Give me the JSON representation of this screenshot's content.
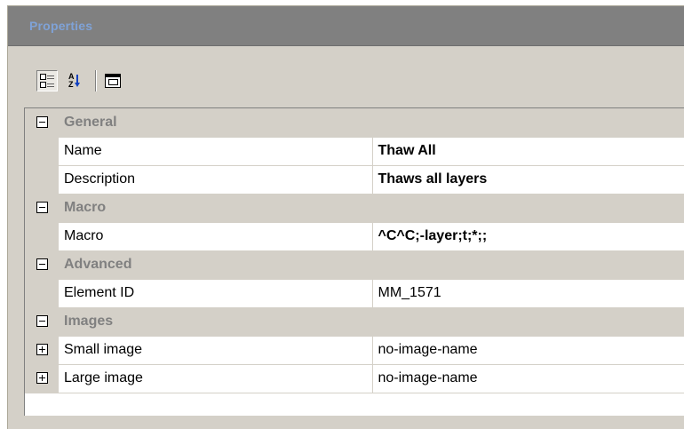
{
  "panel": {
    "title": "Properties"
  },
  "toolbar": {
    "buttons": [
      {
        "icon": "categorized-icon",
        "active": true
      },
      {
        "icon": "alphabetical-sort-icon",
        "label": "A Z",
        "active": false
      },
      {
        "icon": "property-pages-icon",
        "active": false
      }
    ]
  },
  "grid": {
    "categories": [
      {
        "label": "General",
        "expanded": true,
        "properties": [
          {
            "name": "Name",
            "value": "Thaw All",
            "bold": true
          },
          {
            "name": "Description",
            "value": "Thaws all layers",
            "bold": true
          }
        ]
      },
      {
        "label": "Macro",
        "expanded": true,
        "properties": [
          {
            "name": "Macro",
            "value": "^C^C;-layer;t;*;;",
            "bold": true
          }
        ]
      },
      {
        "label": "Advanced",
        "expanded": true,
        "properties": [
          {
            "name": "Element ID",
            "value": "MM_1571",
            "bold": false
          }
        ]
      },
      {
        "label": "Images",
        "expanded": true,
        "properties": [
          {
            "name": "Small image",
            "value": "no-image-name",
            "bold": false,
            "expandable": true
          },
          {
            "name": "Large image",
            "value": "no-image-name",
            "bold": false,
            "expandable": true
          }
        ]
      }
    ]
  },
  "colors": {
    "title_bar": "#808080",
    "title_text": "#7fa2d6",
    "panel_bg": "#d4d0c8",
    "category_text": "#808080"
  }
}
